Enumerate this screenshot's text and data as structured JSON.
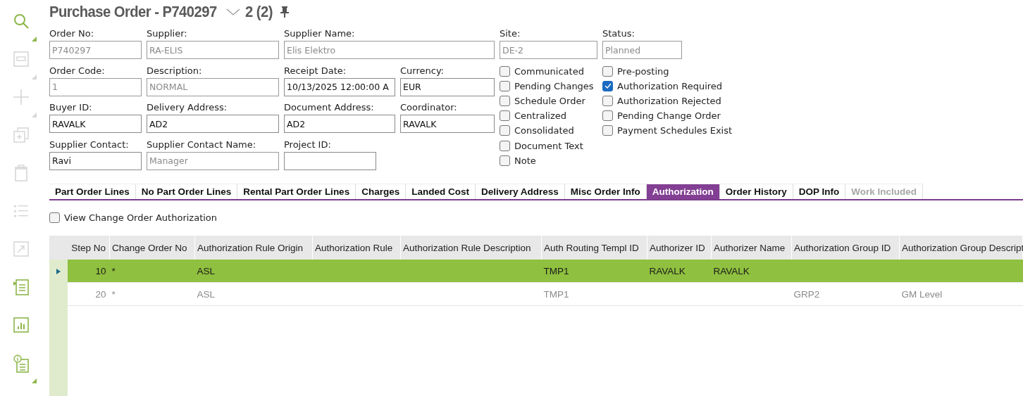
{
  "title": "Purchase Order - P740297",
  "record_count": "2 (2)",
  "sidebar": [
    {
      "kind": "search",
      "disabled": false,
      "corner": true
    },
    {
      "kind": "save",
      "disabled": true,
      "corner": true
    },
    {
      "kind": "add",
      "disabled": true,
      "corner": true
    },
    {
      "kind": "duplicate",
      "disabled": true,
      "corner": false
    },
    {
      "kind": "delete",
      "disabled": true,
      "corner": false
    },
    {
      "kind": "list",
      "disabled": true,
      "corner": false
    },
    {
      "kind": "export",
      "disabled": true,
      "corner": false
    },
    {
      "kind": "lines",
      "disabled": false,
      "corner": false
    },
    {
      "kind": "chart",
      "disabled": false,
      "corner": false
    },
    {
      "kind": "info",
      "disabled": false,
      "corner": true
    }
  ],
  "form_rows": [
    [
      {
        "label": "Order No:",
        "value": "P740297",
        "disabled": true
      },
      {
        "label": "Supplier:",
        "value": "RA-ELIS",
        "disabled": true
      },
      {
        "label": "Supplier Name:",
        "value": "Elis Elektro",
        "disabled": true
      }
    ],
    [
      {
        "label": "Order Code:",
        "value": "1",
        "disabled": true
      },
      {
        "label": "Description:",
        "value": "NORMAL",
        "disabled": true
      },
      {
        "label": "Receipt Date:",
        "value": "10/13/2025 12:00:00 A",
        "disabled": false
      },
      {
        "label": "Currency:",
        "value": "EUR",
        "disabled": false
      }
    ],
    [
      {
        "label": "Buyer ID:",
        "value": "RAVALK",
        "disabled": false
      },
      {
        "label": "Delivery Address:",
        "value": "AD2",
        "disabled": false
      },
      {
        "label": "Document Address:",
        "value": "AD2",
        "disabled": false
      },
      {
        "label": "Coordinator:",
        "value": "RAVALK",
        "disabled": false
      }
    ],
    [
      {
        "label": "Supplier Contact:",
        "value": "Ravi",
        "disabled": false
      },
      {
        "label": "Supplier Contact Name:",
        "value": "Manager",
        "disabled": true
      },
      {
        "label": "Project ID:",
        "disabled": false
      }
    ]
  ],
  "side_fields": [
    {
      "label": "Site:",
      "value": "DE-2",
      "disabled": true
    },
    {
      "label": "Status:",
      "value": "Planned",
      "disabled": true
    }
  ],
  "checkbox_columns": [
    [
      {
        "label": "Communicated",
        "checked": false
      },
      {
        "label": "Pending Changes",
        "checked": false
      },
      {
        "label": "Schedule Order",
        "checked": false
      },
      {
        "label": "Centralized",
        "checked": false
      },
      {
        "label": "Consolidated",
        "checked": false
      },
      {
        "label": "Document Text",
        "checked": false
      },
      {
        "label": "Note",
        "checked": false
      }
    ],
    [
      {
        "label": "Pre-posting",
        "checked": false
      },
      {
        "label": "Authorization Required",
        "checked": true
      },
      {
        "label": "Authorization Rejected",
        "checked": false
      },
      {
        "label": "Pending Change Order",
        "checked": false
      },
      {
        "label": "Payment Schedules Exist",
        "checked": false
      }
    ]
  ],
  "tabs": [
    {
      "label": "Part Order Lines",
      "selected": false,
      "disabled": false
    },
    {
      "label": "No Part Order Lines",
      "selected": false,
      "disabled": false
    },
    {
      "label": "Rental Part Order Lines",
      "selected": false,
      "disabled": false
    },
    {
      "label": "Charges",
      "selected": false,
      "disabled": false
    },
    {
      "label": "Landed Cost",
      "selected": false,
      "disabled": false
    },
    {
      "label": "Delivery Address",
      "selected": false,
      "disabled": false
    },
    {
      "label": "Misc Order Info",
      "selected": false,
      "disabled": false
    },
    {
      "label": "Authorization",
      "selected": true,
      "disabled": false
    },
    {
      "label": "Order History",
      "selected": false,
      "disabled": false
    },
    {
      "label": "DOP Info",
      "selected": false,
      "disabled": false
    },
    {
      "label": "Work Included",
      "selected": false,
      "disabled": true
    }
  ],
  "view_change_order": {
    "label": "View Change Order Authorization",
    "checked": false
  },
  "table": {
    "columns": [
      "Step No",
      "Change Order No",
      "Authorization Rule Origin",
      "Authorization Rule",
      "Authorization Rule Description",
      "Auth Routing Templ ID",
      "Authorizer ID",
      "Authorizer Name",
      "Authorization Group ID",
      "Authorization Group Descript"
    ],
    "rows": [
      {
        "selected": true,
        "cells": [
          "10",
          "*",
          "ASL",
          "",
          "",
          "TMP1",
          "RAVALK",
          "RAVALK",
          "",
          ""
        ]
      },
      {
        "selected": false,
        "cells": [
          "20",
          "*",
          "ASL",
          "",
          "",
          "TMP1",
          "",
          "",
          "GRP2",
          "GM Level"
        ]
      }
    ]
  }
}
